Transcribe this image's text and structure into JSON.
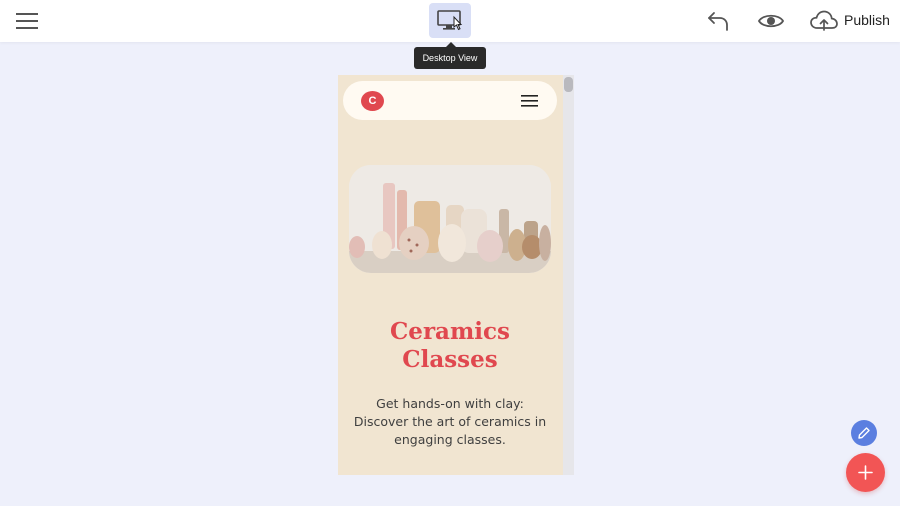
{
  "toolbar": {
    "menu_icon": "hamburger-icon",
    "device_toggle_icon": "desktop-monitor-icon",
    "device_tooltip": "Desktop View",
    "undo_icon": "undo-arrow-icon",
    "preview_icon": "eye-icon",
    "publish_icon": "cloud-upload-icon",
    "publish_label": "Publish"
  },
  "site_preview": {
    "logo_letter": "C",
    "menu_icon": "hamburger-icon",
    "hero_image": "ceramic-vases-photo",
    "title_line1": "Ceramics",
    "title_line2": "Classes",
    "description": "Get hands-on with clay: Discover the art of ceramics in engaging classes."
  },
  "fabs": {
    "edit_icon": "pencil-icon",
    "add_icon": "plus-icon"
  },
  "colors": {
    "accent_red": "#e0484f",
    "fab_red": "#f25555",
    "fab_blue": "#5b7fe0",
    "preview_bg": "#f1e5d1",
    "canvas_bg": "#eef0fb"
  }
}
